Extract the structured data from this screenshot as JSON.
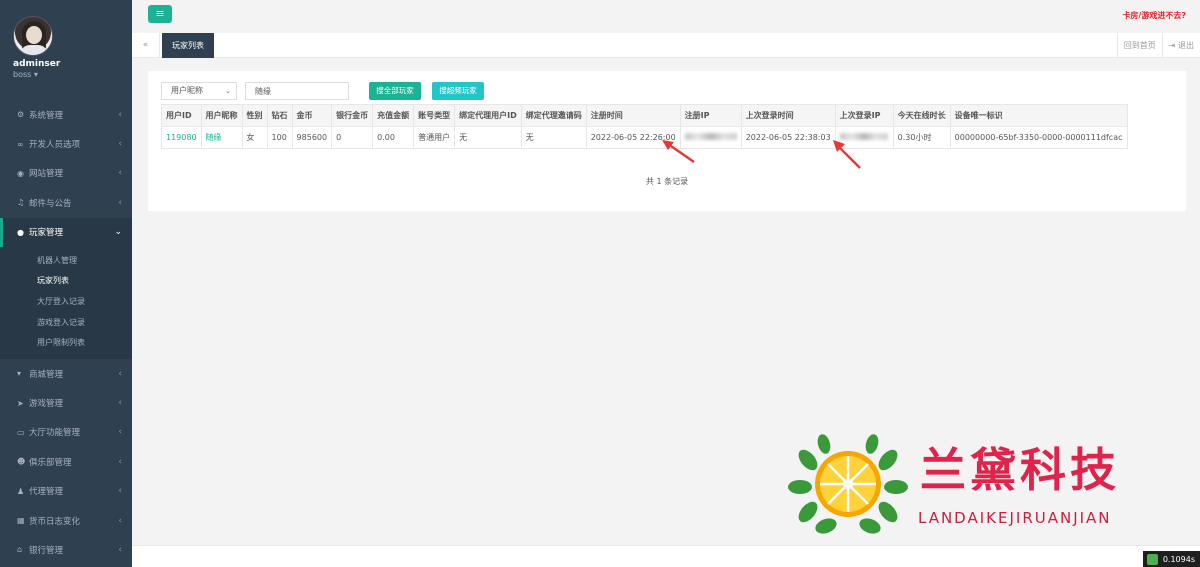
{
  "sidebar": {
    "username": "adminser",
    "role": "boss",
    "menu": [
      {
        "icon": "gears-icon",
        "label": "系统管理"
      },
      {
        "icon": "link-icon",
        "label": "开发人员选项"
      },
      {
        "icon": "globe-icon",
        "label": "网站管理"
      },
      {
        "icon": "bell-icon",
        "label": "邮件与公告"
      },
      {
        "icon": "user-icon",
        "label": "玩家管理"
      },
      {
        "icon": "cart-icon",
        "label": "商城管理"
      },
      {
        "icon": "rocket-icon",
        "label": "游戏管理"
      },
      {
        "icon": "monitor-icon",
        "label": "大厅功能管理"
      },
      {
        "icon": "users-icon",
        "label": "俱乐部管理"
      },
      {
        "icon": "agent-icon",
        "label": "代理管理"
      },
      {
        "icon": "money-icon",
        "label": "货币日志变化"
      },
      {
        "icon": "bank-icon",
        "label": "银行管理"
      }
    ],
    "submenu": [
      "机器人管理",
      "玩家列表",
      "大厅登入记录",
      "游戏登入记录",
      "用户限制列表"
    ]
  },
  "topbar": {
    "right_link": "卡房/游戏进不去?"
  },
  "tabs": {
    "active": "玩家列表",
    "home": "回到首页",
    "logout": "退出"
  },
  "filters": {
    "select_value": "用户昵称",
    "search_value": "随缘",
    "btn_all": "搜全部玩家",
    "btn_exact": "搜超频玩家"
  },
  "table": {
    "headers": [
      "用户ID",
      "用户昵称",
      "性别",
      "钻石",
      "金币",
      "银行金币",
      "充值金额",
      "账号类型",
      "绑定代理用户ID",
      "绑定代理邀请码",
      "注册时间",
      "注册IP",
      "上次登录时间",
      "上次登录IP",
      "今天在线时长",
      "设备唯一标识"
    ],
    "row": {
      "uid": "119080",
      "nickname": "随缘",
      "gender": "女",
      "diamond": "100",
      "gold": "985600",
      "bank_gold": "0",
      "recharge": "0.00",
      "account_type": "普通用户",
      "agent_uid": "无",
      "agent_code": "无",
      "reg_time": "2022-06-05 22:26:00",
      "last_login": "2022-06-05 22:38:03",
      "online": "0.30小时",
      "device": "00000000-65bf-3350-0000-0000111dfcac"
    },
    "total": "共 1 条记录"
  },
  "watermark": {
    "title": "兰黛科技",
    "subtitle": "LANDAIKEJIRUANJIAN"
  },
  "footer": {
    "timer": "0.1094s"
  },
  "colors": {
    "sidebar_bg": "#2f4050",
    "accent": "#1ab394",
    "accent2": "#23c6c8",
    "alert_red": "#ed1c24",
    "watermark_red": "#e0234a"
  }
}
